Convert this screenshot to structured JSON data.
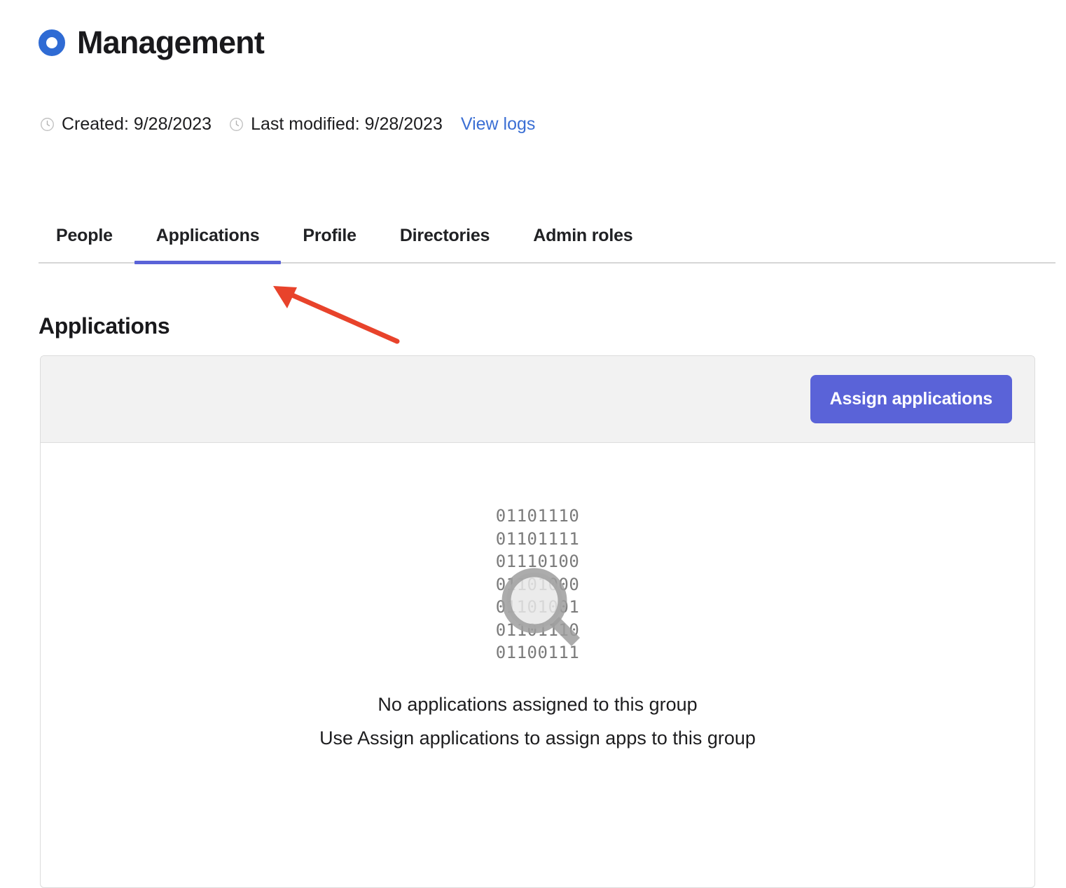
{
  "header": {
    "title": "Management",
    "group_icon": "group-ring-icon"
  },
  "meta": {
    "created_icon": "clock-icon",
    "created_label": "Created: 9/28/2023",
    "modified_icon": "clock-icon",
    "modified_label": "Last modified: 9/28/2023",
    "view_logs_label": "View logs",
    "link_color": "#3b6fd4"
  },
  "tabs": [
    {
      "label": "People",
      "active": false
    },
    {
      "label": "Applications",
      "active": true
    },
    {
      "label": "Profile",
      "active": false
    },
    {
      "label": "Directories",
      "active": false
    },
    {
      "label": "Admin roles",
      "active": false
    }
  ],
  "section": {
    "title": "Applications"
  },
  "panel": {
    "toolbar": {
      "assign_button_label": "Assign applications",
      "assign_button_color": "#5a63d8"
    },
    "empty_state": {
      "illustration_icon": "magnifier-icon",
      "binary_lines": [
        "01101110",
        "01101111",
        "01110100",
        "01101000",
        "01101001",
        "01101110",
        "01100111"
      ],
      "title": "No applications assigned to this group",
      "subtitle": "Use Assign applications to assign apps to this group"
    }
  },
  "annotation": {
    "arrow_icon": "red-arrow-icon",
    "arrow_color": "#e8432b",
    "points_to": "Applications"
  }
}
